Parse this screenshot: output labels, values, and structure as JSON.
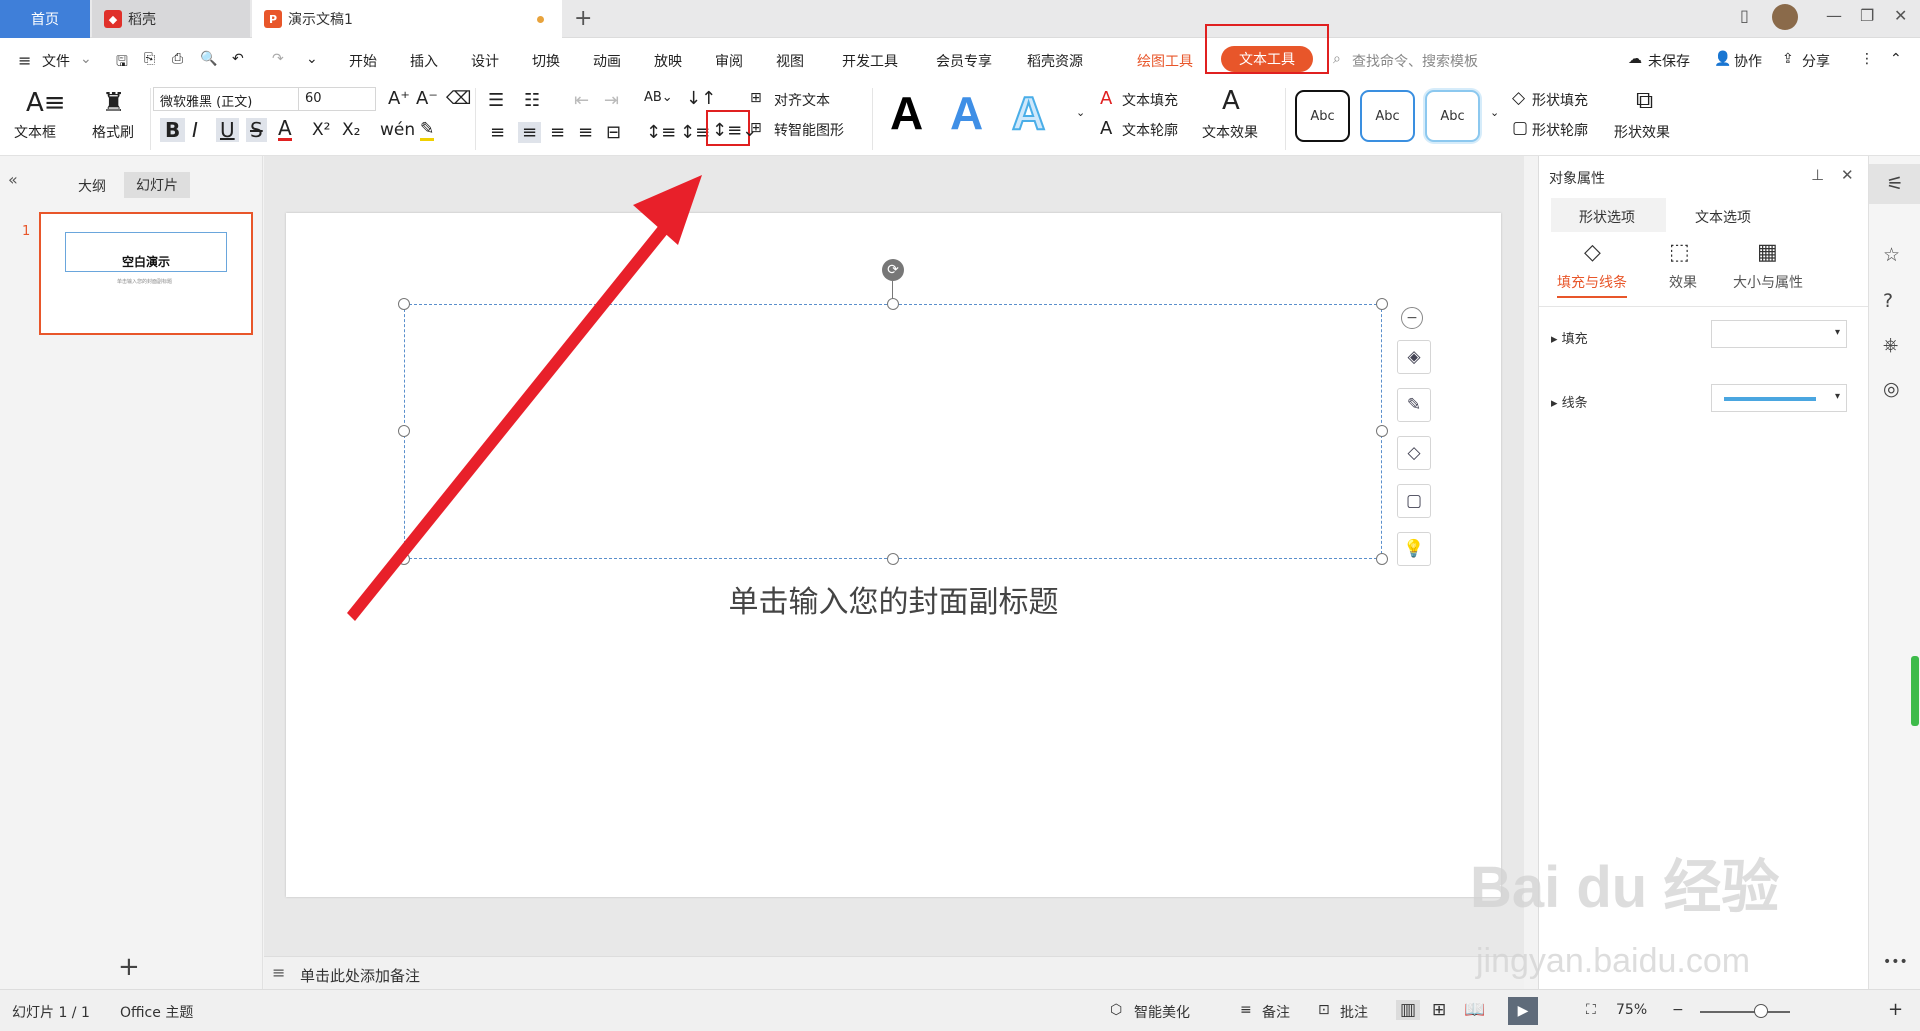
{
  "tabs": {
    "home": "首页",
    "daoke": "稻壳",
    "doc": "演示文稿1",
    "new": "+"
  },
  "menu": {
    "file": "文件",
    "items": [
      "开始",
      "插入",
      "设计",
      "切换",
      "动画",
      "放映",
      "审阅",
      "视图",
      "开发工具",
      "会员专享",
      "稻壳资源"
    ],
    "draw_tools": "绘图工具",
    "text_tools": "文本工具",
    "search_placeholder": "查找命令、搜索模板",
    "unsaved": "未保存",
    "collab": "协作",
    "share": "分享"
  },
  "ribbon": {
    "textbox": "文本框",
    "format_brush": "格式刷",
    "font_name": "微软雅黑 (正文)",
    "font_size": "60",
    "align_text": "对齐文本",
    "smart_shape": "转智能图形",
    "text_fill": "文本填充",
    "text_outline": "文本轮廓",
    "text_effect": "文本效果",
    "abc1": "Abc",
    "abc2": "Abc",
    "abc3": "Abc",
    "shape_fill": "形状填充",
    "shape_outline": "形状轮廓",
    "shape_effect": "形状效果",
    "bold": "B",
    "italic": "I",
    "underline": "U",
    "strike": "S",
    "font_color": "A",
    "superscript": "X²",
    "subscript": "X₂",
    "bigA": "A"
  },
  "left": {
    "outline": "大纲",
    "slides": "幻灯片",
    "slide_num": "1",
    "thumb_title": "空白演示",
    "thumb_sub": "单击输入您的封面副标题",
    "add": "+"
  },
  "slide": {
    "subtitle": "单击输入您的封面副标题"
  },
  "notes": {
    "placeholder": "单击此处添加备注"
  },
  "right": {
    "title": "对象属性",
    "tab_shape": "形状选项",
    "tab_text": "文本选项",
    "sub_fill_line": "填充与线条",
    "sub_effect": "效果",
    "sub_size": "大小与属性",
    "fill": "填充",
    "line": "线条",
    "line_color": "#4aa6e0"
  },
  "status": {
    "slide_info": "幻灯片 1 / 1",
    "theme": "Office 主题",
    "beautify": "智能美化",
    "notes": "备注",
    "comment": "批注",
    "zoom": "75%"
  },
  "watermark": {
    "brand": "Bai du 经验",
    "url": "jingyan.baidu.com"
  },
  "colors": {
    "accent": "#e8562a",
    "blue": "#3f7fd9",
    "arrow": "#e8202a"
  }
}
